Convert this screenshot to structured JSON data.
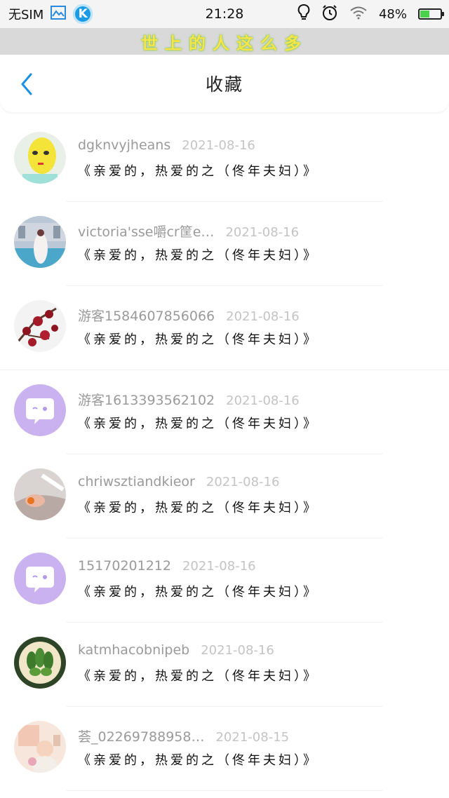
{
  "status_bar": {
    "carrier": "无SIM",
    "k_label": "K",
    "time": "21:28",
    "battery_text": "48%",
    "battery_level": 0.48
  },
  "banner": {
    "text": "世上的人这么多"
  },
  "header": {
    "title": "收藏"
  },
  "favorites": [
    {
      "username": "dgknvyjheans",
      "date": "2021-08-16",
      "message": "《亲爱的，热爱的之（佟年夫妇）》",
      "avatar": "yellow-face-photo"
    },
    {
      "username": "victoria'sse嚼cr筐e…",
      "date": "2021-08-16",
      "message": "《亲爱的，热爱的之（佟年夫妇）》",
      "avatar": "wedding-photo"
    },
    {
      "username": "游客1584607856066",
      "date": "2021-08-16",
      "message": "《亲爱的，热爱的之（佟年夫妇）》",
      "avatar": "plum-blossom-photo"
    },
    {
      "username": "游客1613393562102",
      "date": "2021-08-16",
      "message": "《亲爱的，热爱的之（佟年夫妇）》",
      "avatar": "default-chat-avatar"
    },
    {
      "username": "chriwsztiandkieor",
      "date": "2021-08-16",
      "message": "《亲爱的，热爱的之（佟年夫妇）》",
      "avatar": "hand-photo"
    },
    {
      "username": "15170201212",
      "date": "2021-08-16",
      "message": "《亲爱的，热爱的之（佟年夫妇）》",
      "avatar": "default-chat-avatar"
    },
    {
      "username": "katmhacobnipeb",
      "date": "2021-08-16",
      "message": "《亲爱的，热爱的之（佟年夫妇）》",
      "avatar": "leaf-plate-photo"
    },
    {
      "username": "荟_02269788958…",
      "date": "2021-08-15",
      "message": "《亲爱的，热爱的之（佟年夫妇）》",
      "avatar": "child-photo"
    }
  ],
  "colors": {
    "accent": "#1a8fe3",
    "username": "#9a9a9a",
    "date": "#c4c4c4",
    "default_avatar": "#c9b2ef"
  }
}
